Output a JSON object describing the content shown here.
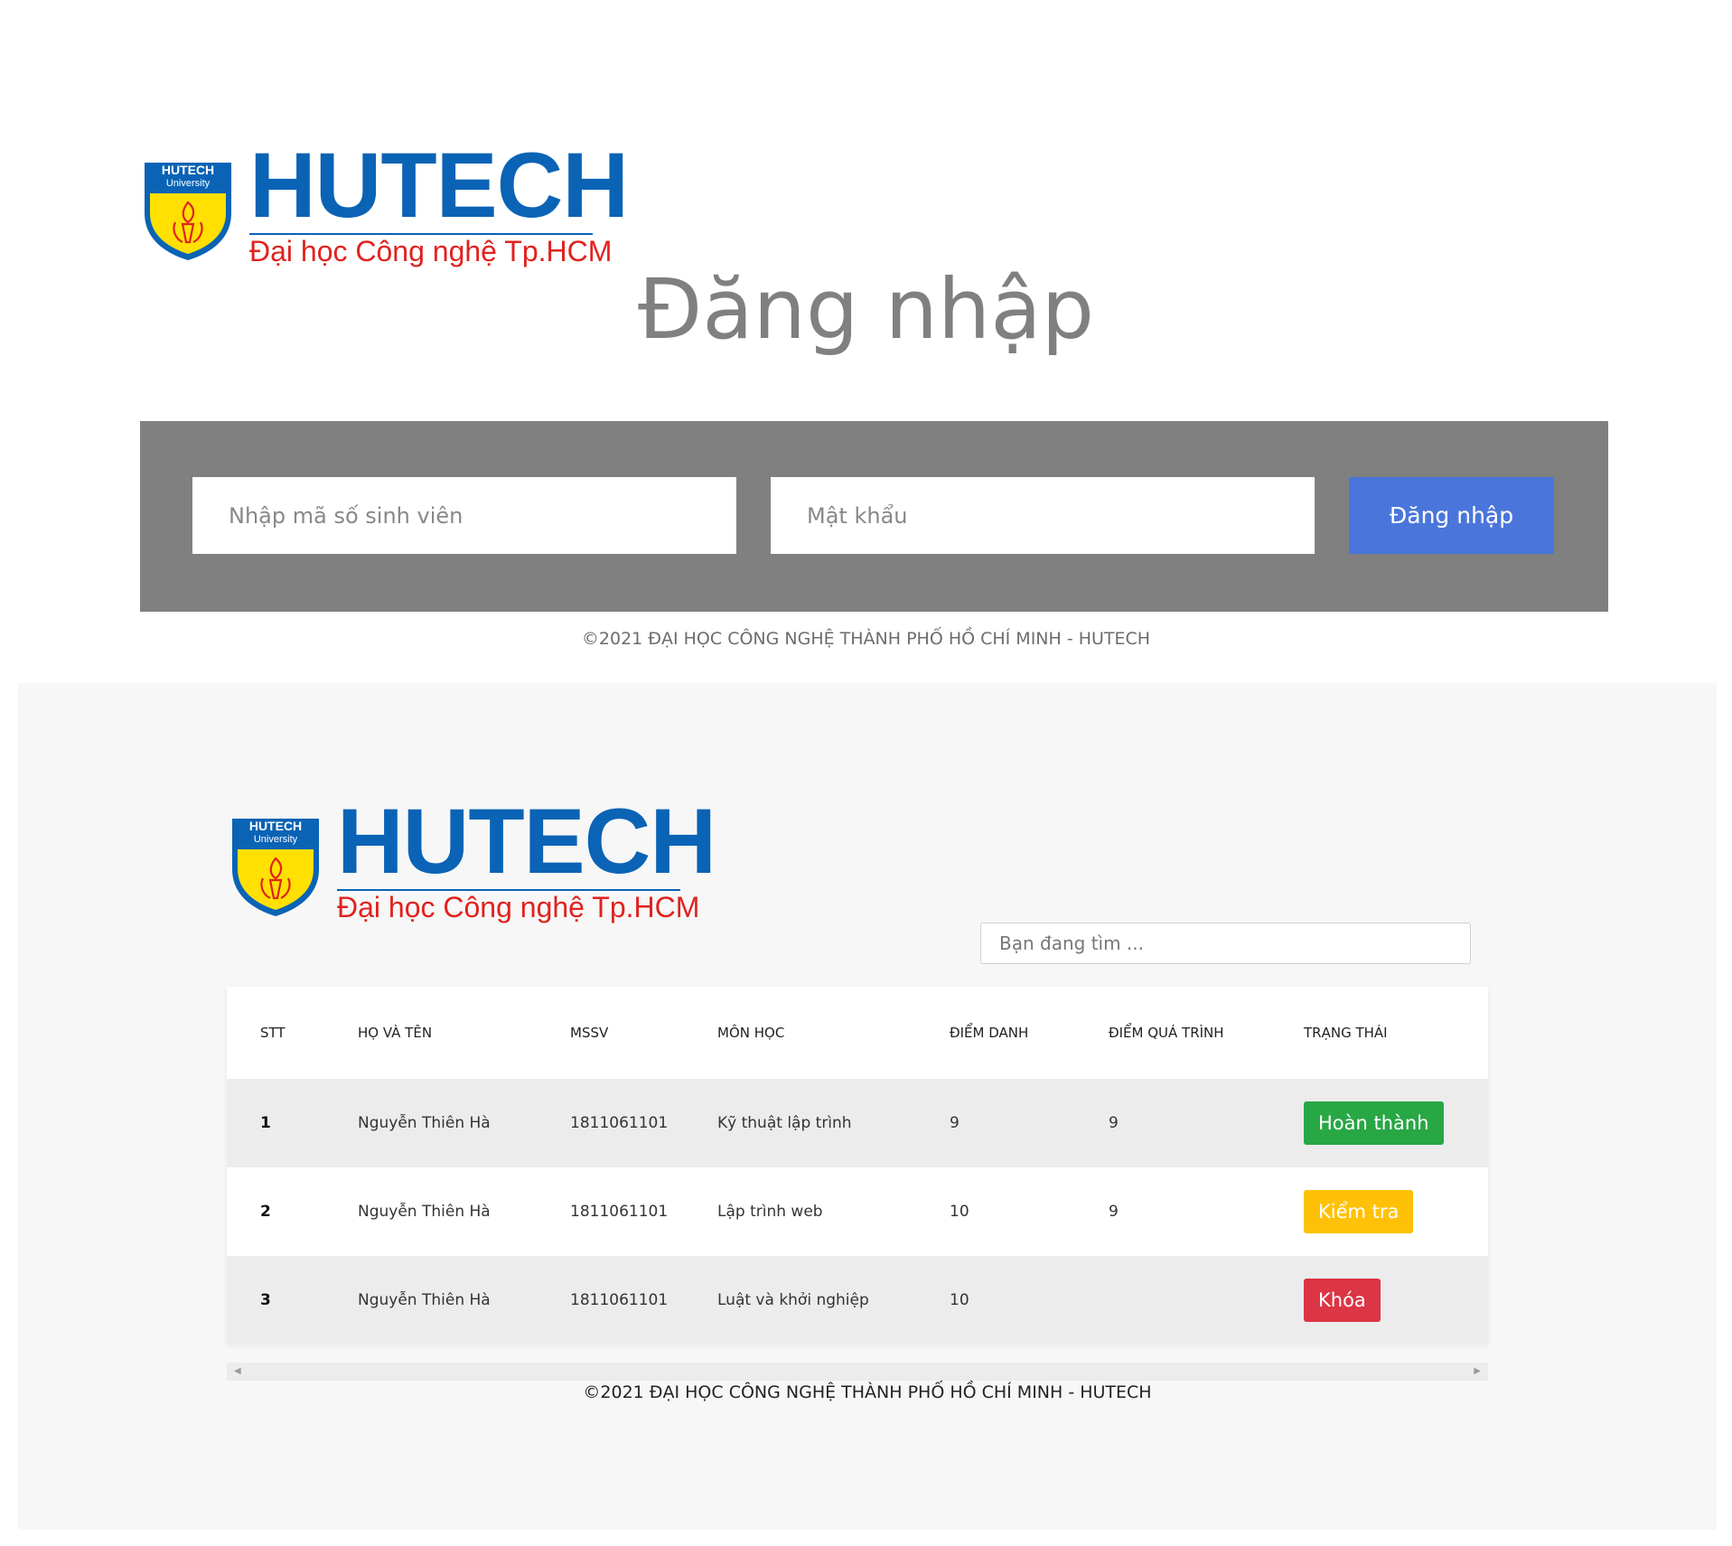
{
  "brand": {
    "badge_line1": "HUTECH",
    "badge_line2": "University",
    "wordmark": "HUTECH",
    "tagline": "Đại học Công nghệ Tp.HCM",
    "colors": {
      "blue": "#0a63b5",
      "red": "#e0221f",
      "yellow": "#ffe000"
    }
  },
  "login": {
    "title": "Đăng nhập",
    "student_id_placeholder": "Nhập mã số sinh viên",
    "password_placeholder": "Mật khẩu",
    "submit_label": "Đăng nhập",
    "footer": "©2021 ĐẠI HỌC CÔNG NGHỆ THÀNH PHỐ HỒ CHÍ MINH - HUTECH"
  },
  "dashboard": {
    "search_placeholder": "Bạn đang tìm ...",
    "columns": [
      "STT",
      "HỌ VÀ TÊN",
      "MSSV",
      "MÔN HỌC",
      "ĐIỂM DANH",
      "ĐIỂM QUÁ TRÌNH",
      "TRẠNG THÁI"
    ],
    "rows": [
      {
        "stt": "1",
        "name": "Nguyễn Thiên Hà",
        "mssv": "1811061101",
        "subject": "Kỹ thuật lập trình",
        "attendance": "9",
        "process": "9",
        "status": "Hoàn thành",
        "status_color": "#28a745"
      },
      {
        "stt": "2",
        "name": "Nguyễn Thiên Hà",
        "mssv": "1811061101",
        "subject": "Lập trình web",
        "attendance": "10",
        "process": "9",
        "status": "Kiểm tra",
        "status_color": "#ffc107"
      },
      {
        "stt": "3",
        "name": "Nguyễn Thiên Hà",
        "mssv": "1811061101",
        "subject": "Luật và khởi nghiệp",
        "attendance": "10",
        "process": "",
        "status": "Khóa",
        "status_color": "#dc3545"
      }
    ],
    "footer": "©2021 ĐẠI HỌC CÔNG NGHỆ THÀNH PHỐ HỒ CHÍ MINH - HUTECH"
  },
  "icons": {
    "scroll_left": "caret-left-icon",
    "scroll_right": "caret-right-icon",
    "logo_torch": "torch-icon"
  }
}
